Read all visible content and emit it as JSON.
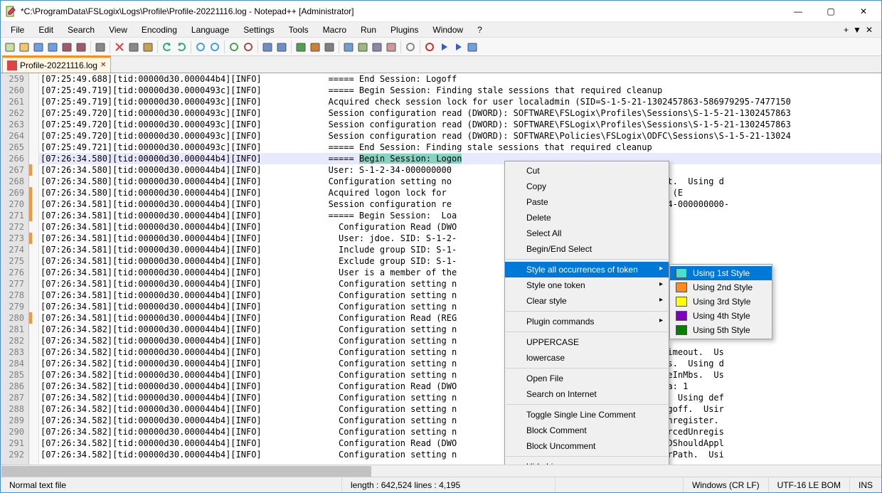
{
  "title": "*C:\\ProgramData\\FSLogix\\Logs\\Profile\\Profile-20221116.log - Notepad++ [Administrator]",
  "menus": {
    "items": [
      "File",
      "Edit",
      "Search",
      "View",
      "Encoding",
      "Language",
      "Settings",
      "Tools",
      "Macro",
      "Run",
      "Plugins",
      "Window",
      "?"
    ]
  },
  "menubar_right": {
    "plus": "+",
    "dropdown": "▼",
    "close": "✕"
  },
  "win_controls": {
    "min": "—",
    "max": "▢",
    "close": "✕"
  },
  "tab": {
    "label": "Profile-20221116.log",
    "close": "✕"
  },
  "first_line_no": 259,
  "highlighted_row_index": 7,
  "highlighted_text": "Begin Session: Logon",
  "change_markers": [
    8,
    10,
    11,
    12,
    14,
    21
  ],
  "lines": [
    "[07:25:49.688][tid:00000d30.000044b4][INFO]             ===== End Session: Logoff",
    "[07:25:49.719][tid:00000d30.0000493c][INFO]             ===== Begin Session: Finding stale sessions that required cleanup",
    "[07:25:49.719][tid:00000d30.0000493c][INFO]             Acquired check session lock for user localadmin (SID=S-1-5-21-1302457863-586979295-7477150",
    "[07:25:49.720][tid:00000d30.0000493c][INFO]             Session configuration read (DWORD): SOFTWARE\\FSLogix\\Profiles\\Sessions\\S-1-5-21-1302457863",
    "[07:25:49.720][tid:00000d30.0000493c][INFO]             Session configuration read (DWORD): SOFTWARE\\FSLogix\\Profiles\\Sessions\\S-1-5-21-1302457863",
    "[07:25:49.720][tid:00000d30.0000493c][INFO]             Session configuration read (DWORD): SOFTWARE\\Policies\\FSLogix\\ODFC\\Sessions\\S-1-5-21-13024",
    "[07:25:49.721][tid:00000d30.0000493c][INFO]             ===== End Session: Finding stale sessions that required cleanup",
    "[07:26:34.580][tid:00000d30.000044b4][INFO]             ===== Begin Session: Logon",
    "[07:26:34.580][tid:00000d30.000044b4][INFO]             User: S-1-2-34-000000000                  jdoe)",
    "[07:26:34.580][tid:00000d30.000044b4][INFO]             Configuration setting no                  les\\LogonSyncMutexTimeout.  Using d",
    "[07:26:34.580][tid:00000d30.000044b4][INFO]             Acquired logon lock for                   000000000000000-0000000) (E",
    "[07:26:34.581][tid:00000d30.000044b4][INFO]             Session configuration re                  rofiles\\Sessions\\S-1-2-34-000000000-",
    "[07:26:34.581][tid:00000d30.000044b4][INFO]             ===== Begin Session:  Loa",
    "[07:26:34.581][tid:00000d30.000044b4][INFO]               Configuration Read (DWO                 Enabled.  Data: 1",
    "[07:26:34.581][tid:00000d30.000044b4][INFO]               User: jdoe. SID: S-1-2-                 00-0000000.",
    "[07:26:34.581][tid:00000d30.000044b4][INFO]               Include group SID: S-1-                 6000-1000",
    "[07:26:34.581][tid:00000d30.000044b4][INFO]               Exclude group SID: S-1-                 6000-1001",
    "[07:26:34.581][tid:00000d30.000044b4][INFO]               User is a member of the",
    "[07:26:34.581][tid:00000d30.000044b4][INFO]               Configuration setting n                                        sing default:",
    "[07:26:34.581][tid:00000d30.000044b4][INFO]               Configuration setting n                                        omputerObject.",
    "[07:26:34.581][tid:00000d30.000044b4][INFO]               Configuration setting n                                        kAsComputerOb",
    "[07:26:34.581][tid:00000d30.000044b4][INFO]               Configuration Read (REG                                        O:%sid%D:P(A",
    "[07:26:34.582][tid:00000d30.000044b4][INFO]               Configuration setting n                                        DL.  Using def",
    "[07:26:34.582][tid:00000d30.000044b4][INFO]               Configuration setting n                 eout.  Using d",
    "[07:26:34.582][tid:00000d30.000044b4][INFO]               Configuration setting n                 ogix\\ODFC\\CcdUnregisterTimeout.  Us",
    "[07:26:34.582][tid:00000d30.000044b4][INFO]               Configuration setting n                 iles\\CCDMaxCacheSizeInMbs.  Using d",
    "[07:26:34.582][tid:00000d30.000044b4][INFO]               Configuration setting n                 ogix\\ODFC\\CCDMaxCacheSizeInMbs.  Us",
    "[07:26:34.582][tid:00000d30.000044b4][INFO]               Configuration Read (DWO                 nupInvalidSessions.  Data: 1",
    "[07:26:34.582][tid:00000d30.000044b4][INFO]               Configuration setting n                 iles\\ClearCacheOnLogoff.  Using def",
    "[07:26:34.582][tid:00000d30.000044b4][INFO]               Configuration setting n                 ogix\\ODFC\\ClearCacheOnLogoff.  Usir",
    "[07:26:34.582][tid:00000d30.000044b4][INFO]               Configuration setting n                 iles\\ClearCacheOnForcedUnregister.",
    "[07:26:34.582][tid:00000d30.000044b4][INFO]               Configuration setting n                 ogix\\ODFC\\ClearCacheOnForcedUnregis",
    "[07:26:34.582][tid:00000d30.000044b4][INFO]               Configuration Read (DWO                 DeleteLocalProfileWhenVHDShouldAppl",
    "[07:26:34.582][tid:00000d30.000044b4][INFO]               Configuration setting n                 iles\\DiffDiskParentFolderPath.  Usi"
  ],
  "context_menu": {
    "items": [
      {
        "label": "Cut"
      },
      {
        "label": "Copy"
      },
      {
        "label": "Paste"
      },
      {
        "label": "Delete"
      },
      {
        "label": "Select All"
      },
      {
        "label": "Begin/End Select"
      },
      {
        "sep": true
      },
      {
        "label": "Style all occurrences of token",
        "sub": true,
        "hi": true
      },
      {
        "label": "Style one token",
        "sub": true
      },
      {
        "label": "Clear style",
        "sub": true
      },
      {
        "sep": true
      },
      {
        "label": "Plugin commands",
        "sub": true
      },
      {
        "sep": true
      },
      {
        "label": "UPPERCASE"
      },
      {
        "label": "lowercase"
      },
      {
        "sep": true
      },
      {
        "label": "Open File"
      },
      {
        "label": "Search on Internet"
      },
      {
        "sep": true
      },
      {
        "label": "Toggle Single Line Comment"
      },
      {
        "label": "Block Comment"
      },
      {
        "label": "Block Uncomment"
      },
      {
        "sep": true
      },
      {
        "label": "Hide Lines"
      }
    ]
  },
  "submenu": {
    "items": [
      {
        "label": "Using 1st Style",
        "color": "#48e0d0",
        "hi": true
      },
      {
        "label": "Using 2nd Style",
        "color": "#ff8c1a"
      },
      {
        "label": "Using 3rd Style",
        "color": "#ffff00"
      },
      {
        "label": "Using 4th Style",
        "color": "#8000c0"
      },
      {
        "label": "Using 5th Style",
        "color": "#008000"
      }
    ]
  },
  "status": {
    "left": "Normal text file",
    "length": "length : 642,524    lines : 4,195",
    "eol": "Windows (CR LF)",
    "enc": "UTF-16 LE BOM",
    "mode": "INS"
  }
}
